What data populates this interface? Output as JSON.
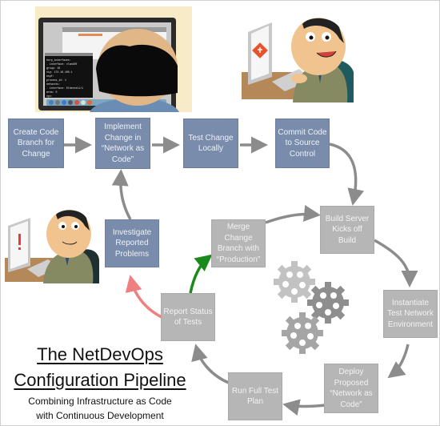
{
  "diagram": {
    "title_line1": "The NetDevOps",
    "title_line2": "Configuration Pipeline",
    "subtitle_line1": "Combining Infrastructure as Code",
    "subtitle_line2": "with Continuous Development",
    "colors": {
      "developer_step": "#7a8cab",
      "automated_step": "#b6b6b6",
      "arrow": "#8c8c8c",
      "success_arrow": "#1a8a1a",
      "failure_arrow": "#f08080"
    },
    "developer_steps": [
      {
        "id": "create-branch",
        "label": "Create Code Branch for Change"
      },
      {
        "id": "implement-change",
        "label": "Implement Change in “Network as Code”"
      },
      {
        "id": "test-locally",
        "label": "Test Change Locally"
      },
      {
        "id": "commit-code",
        "label": "Commit Code to Source Control"
      },
      {
        "id": "investigate",
        "label": "Investigate Reported Problems"
      }
    ],
    "automated_steps": [
      {
        "id": "build-server",
        "label": "Build Server Kicks off Build"
      },
      {
        "id": "instantiate-test",
        "label": "Instantiate Test Network Environment"
      },
      {
        "id": "deploy-proposed",
        "label": "Deploy Proposed “Network as Code”"
      },
      {
        "id": "run-tests",
        "label": "Run Full Test Plan"
      },
      {
        "id": "report-status",
        "label": "Report Status of Tests"
      },
      {
        "id": "merge-production",
        "label": "Merge Change Branch with “Production”"
      }
    ],
    "illustrations": {
      "developer_at_monitor": "developer-viewing-code-icon",
      "developer_git": "developer-git-commit-icon",
      "developer_alert": "developer-alert-icon",
      "gears": "gears-icon"
    },
    "terminal_lines": [
      "hsrp_interfaces:",
      "  - interface: vlan100",
      "    group: 10",
      "    vip: 172.16.100.1",
      "ospf:",
      "  process_id: 1",
      "  networks:",
      "    - interface: Ethernet1/1",
      "      area: 0",
      "vpc:"
    ]
  }
}
